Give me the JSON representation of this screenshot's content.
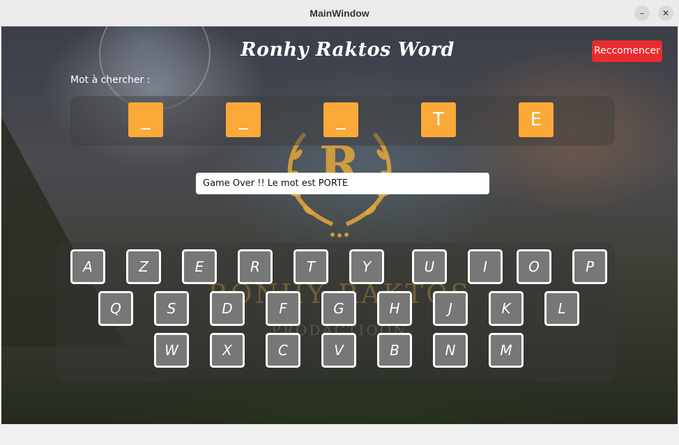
{
  "window": {
    "title": "MainWindow",
    "minimize_icon": "–",
    "close_icon": "✕"
  },
  "app": {
    "title": "Ronhy Raktos Word",
    "restart_label": "Reccomencer",
    "prompt_label": "Mot à chercher :",
    "message": "Game Over !! Le mot est PORTE"
  },
  "word_slots": [
    "_",
    "_",
    "_",
    "T",
    "E"
  ],
  "keyboard": {
    "row1": [
      "A",
      "Z",
      "E",
      "R",
      "T",
      "Y",
      "U",
      "I",
      "O",
      "P"
    ],
    "row2": [
      "Q",
      "S",
      "D",
      "F",
      "G",
      "H",
      "J",
      "K",
      "L"
    ],
    "row3": [
      "W",
      "X",
      "C",
      "V",
      "B",
      "N",
      "M"
    ]
  },
  "background_logo": {
    "monogram": "R",
    "name": "RONHY RAKTOS",
    "tagline": "PRODACTIOON"
  },
  "colors": {
    "slot": "#fba938",
    "restart": "#ea2c2f",
    "key": "#777777"
  }
}
